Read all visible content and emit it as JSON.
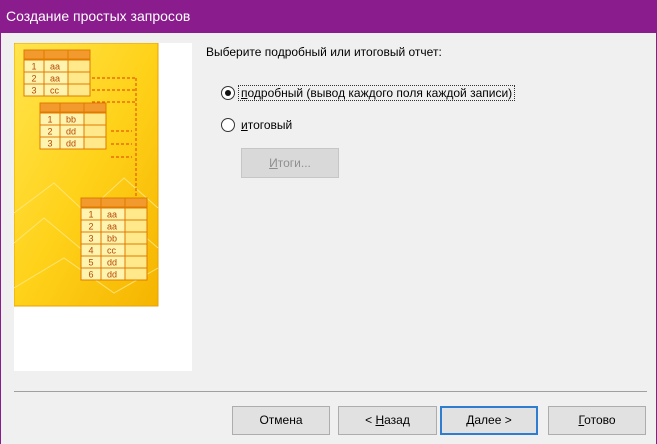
{
  "window": {
    "title": "Создание простых запросов",
    "accent_color": "#8a1c8e"
  },
  "prompt": "Выберите подробный или итоговый отчет:",
  "options": [
    {
      "pre": "",
      "key": "п",
      "post": "одробный (вывод каждого поля каждой записи)",
      "checked": true
    },
    {
      "pre": "",
      "key": "и",
      "post": "тоговый",
      "checked": false
    }
  ],
  "totals_button": {
    "pre": "",
    "key": "И",
    "post": "тоги..."
  },
  "illustration": {
    "table1": [
      [
        "1",
        "aa"
      ],
      [
        "2",
        "aa"
      ],
      [
        "3",
        "cc"
      ]
    ],
    "table2": [
      [
        "1",
        "bb"
      ],
      [
        "2",
        "dd"
      ],
      [
        "3",
        "dd"
      ]
    ],
    "table3": [
      [
        "1",
        "aa"
      ],
      [
        "2",
        "aa"
      ],
      [
        "3",
        "bb"
      ],
      [
        "4",
        "cc"
      ],
      [
        "5",
        "dd"
      ],
      [
        "6",
        "dd"
      ]
    ]
  },
  "buttons": {
    "cancel": "Отмена",
    "back": {
      "pre": "< ",
      "key": "Н",
      "post": "азад"
    },
    "next": {
      "pre": "",
      "key": "Д",
      "post": "алее >"
    },
    "finish": {
      "pre": "",
      "key": "Г",
      "post": "отово"
    }
  }
}
